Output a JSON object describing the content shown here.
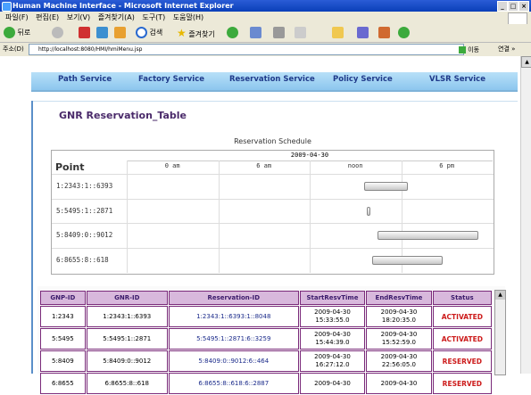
{
  "window": {
    "title": "Human Machine Interface - Microsoft Internet Explorer",
    "min": "_",
    "max": "□",
    "close": "×"
  },
  "menu": [
    "파일(F)",
    "편집(E)",
    "보기(V)",
    "즐겨찾기(A)",
    "도구(T)",
    "도움말(H)"
  ],
  "toolbar": {
    "back": "뒤로",
    "search": "검색",
    "favorites": "즐겨찾기"
  },
  "address": {
    "label": "주소(D)",
    "url": "http://localhost:8080/HMI/hmiMenu.jsp",
    "go": "이동",
    "links": "연결 »"
  },
  "nav": [
    "Path Service",
    "Factory Service",
    "Reservation Service",
    "Policy Service",
    "VLSR Service"
  ],
  "heading": "GNR Reservation_Table",
  "chart_data": {
    "type": "gantt",
    "title": "Reservation Schedule",
    "date": "2009-04-30",
    "x_ticks": [
      "0 am",
      "6 am",
      "noon",
      "6 pm"
    ],
    "row_header": "Point",
    "rows": [
      {
        "label": "1:2343:1::6393",
        "start": 15.56,
        "end": 18.34
      },
      {
        "label": "5:5495:1::2871",
        "start": 15.74,
        "end": 15.88
      },
      {
        "label": "5:8409:0::9012",
        "start": 16.45,
        "end": 22.93
      },
      {
        "label": "6:8655:8::618",
        "start": 16.1,
        "end": 20.6
      }
    ]
  },
  "table": {
    "headers": [
      "GNP-ID",
      "GNR-ID",
      "Reservation-ID",
      "StartResvTime",
      "EndResvTime",
      "Status"
    ],
    "rows": [
      {
        "gnp": "1:2343",
        "gnr": "1:2343:1::6393",
        "resv": "1:2343:1::6393:1::8048",
        "start": "2009-04-30 15:33:55.0",
        "end": "2009-04-30 18:20:35.0",
        "status": "ACTIVATED"
      },
      {
        "gnp": "5:5495",
        "gnr": "5:5495:1::2871",
        "resv": "5:5495:1::2871:6::3259",
        "start": "2009-04-30 15:44:39.0",
        "end": "2009-04-30 15:52:59.0",
        "status": "ACTIVATED"
      },
      {
        "gnp": "5:8409",
        "gnr": "5:8409:0::9012",
        "resv": "5:8409:0::9012:6::464",
        "start": "2009-04-30 16:27:12.0",
        "end": "2009-04-30 22:56:05.0",
        "status": "RESERVED"
      },
      {
        "gnp": "6:8655",
        "gnr": "6:8655:8::618",
        "resv": "6:8655:8::618:6::2887",
        "start": "2009-04-30",
        "end": "2009-04-30",
        "status": "RESERVED"
      }
    ]
  }
}
